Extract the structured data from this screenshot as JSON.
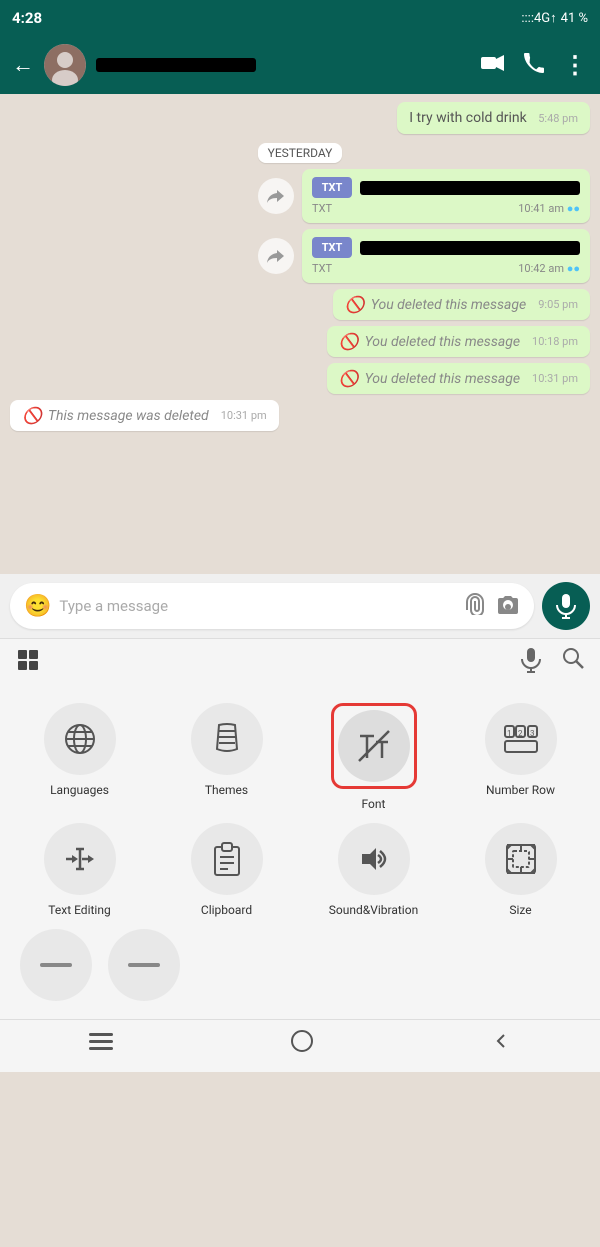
{
  "statusBar": {
    "time": "4:28",
    "network": "4G",
    "battery": "41 %"
  },
  "header": {
    "backLabel": "←",
    "contactNamePlaceholder": "",
    "videoCallIcon": "📹",
    "callIcon": "📞",
    "menuIcon": "⋮"
  },
  "chat": {
    "dateDivider": "YESTERDAY",
    "messages": [
      {
        "id": "msg1",
        "type": "file-sent",
        "fileType": "TXT",
        "time": "10:41 am",
        "ticks": "●●"
      },
      {
        "id": "msg2",
        "type": "file-sent",
        "fileType": "TXT",
        "time": "10:42 am",
        "ticks": "●●"
      },
      {
        "id": "msg3",
        "type": "deleted-sent",
        "text": "You deleted this message",
        "time": "9:05 pm"
      },
      {
        "id": "msg4",
        "type": "deleted-sent",
        "text": "You deleted this message",
        "time": "10:18 pm"
      },
      {
        "id": "msg5",
        "type": "deleted-sent",
        "text": "You deleted this message",
        "time": "10:31 pm"
      },
      {
        "id": "msg6",
        "type": "deleted-received",
        "text": "This message was deleted",
        "time": "10:31 pm"
      }
    ]
  },
  "inputBar": {
    "placeholder": "Type a message",
    "emojiIcon": "😊",
    "attachIcon": "📎",
    "cameraIcon": "📷",
    "micIcon": "🎤"
  },
  "keyboardToolbar": {
    "gridIcon": "⊞",
    "micIcon": "🎤",
    "searchIcon": "🔍"
  },
  "keyboardSettings": {
    "items": [
      {
        "id": "languages",
        "label": "Languages",
        "icon": "🌐",
        "highlighted": false
      },
      {
        "id": "themes",
        "label": "Themes",
        "icon": "👕",
        "highlighted": false
      },
      {
        "id": "font",
        "label": "Font",
        "icon": "𝒯",
        "highlighted": true
      },
      {
        "id": "number-row",
        "label": "Number Row",
        "icon": "🔢",
        "highlighted": false
      },
      {
        "id": "text-editing",
        "label": "Text Editing",
        "icon": "⇔",
        "highlighted": false
      },
      {
        "id": "clipboard",
        "label": "Clipboard",
        "icon": "📋",
        "highlighted": false
      },
      {
        "id": "sound-vibration",
        "label": "Sound&Vibration",
        "icon": "🔊",
        "highlighted": false
      },
      {
        "id": "size",
        "label": "Size",
        "icon": "⛶",
        "highlighted": false
      }
    ],
    "partialItems": [
      {
        "id": "partial1",
        "icon": "—"
      },
      {
        "id": "partial2",
        "icon": "—"
      }
    ]
  },
  "bottomNav": {
    "menuIcon": "≡",
    "homeIcon": "○",
    "backIcon": "◁"
  }
}
